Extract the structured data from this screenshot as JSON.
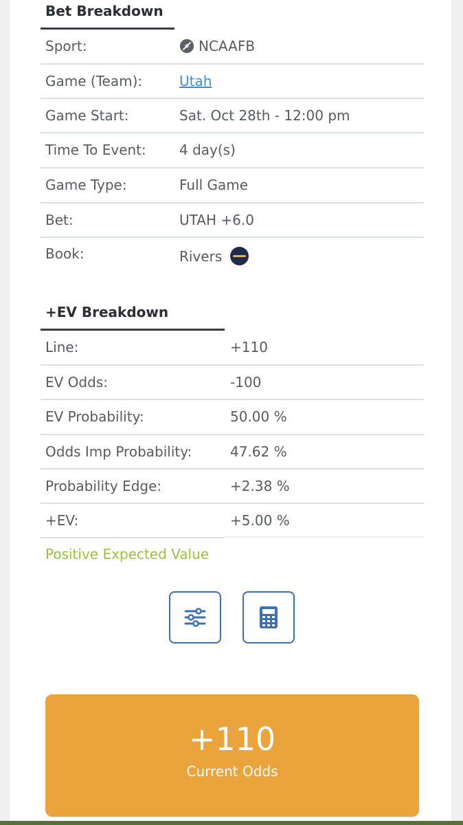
{
  "bet_breakdown": {
    "title": "Bet Breakdown",
    "rows": [
      {
        "label": "Sport:",
        "value": "NCAAFB",
        "icon": "football-icon"
      },
      {
        "label": "Game (Team):",
        "value": "Utah"
      },
      {
        "label": "Game Start:",
        "value": "Sat. Oct 28th - 12:00 pm"
      },
      {
        "label": "Time To Event:",
        "value": "4 day(s)"
      },
      {
        "label": "Game Type:",
        "value": "Full Game"
      },
      {
        "label": "Bet:",
        "value": "UTAH +6.0"
      },
      {
        "label": "Book:",
        "value": "Rivers",
        "icon": "rivers-logo"
      }
    ]
  },
  "ev_breakdown": {
    "title": "+EV Breakdown",
    "rows": [
      {
        "label": "Line:",
        "value": "+110"
      },
      {
        "label": "EV Odds:",
        "value": "-100"
      },
      {
        "label": "EV Probability:",
        "value": "50.00 %"
      },
      {
        "label": "Odds Imp Probability:",
        "value": "47.62 %"
      },
      {
        "label": "Probability Edge:",
        "value": "+2.38 %"
      },
      {
        "label": "+EV:",
        "value": "+5.00 %"
      }
    ],
    "verdict": "Positive Expected Value"
  },
  "actions": {
    "settings_icon": "sliders-icon",
    "calculator_icon": "calculator-icon"
  },
  "odds_card": {
    "value": "+110",
    "label": "Current Odds"
  },
  "colors": {
    "accent_orange": "#eba43c",
    "positive_green": "#9bc13b",
    "link_blue": "#3b8fd8",
    "button_blue": "#3b6fb8"
  }
}
